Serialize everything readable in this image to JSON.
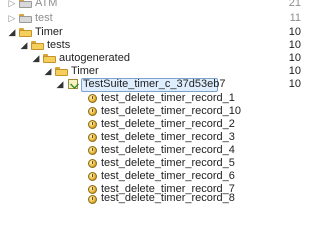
{
  "tree": {
    "rows": [
      {
        "label": "ATM",
        "count": "21",
        "dim": true
      },
      {
        "label": "test",
        "count": "11",
        "dim": true
      },
      {
        "label": "Timer",
        "count": "10"
      },
      {
        "label": "tests",
        "count": "10"
      },
      {
        "label": "autogenerated",
        "count": "10"
      },
      {
        "label": "Timer",
        "count": "10"
      },
      {
        "label": "TestSuite_timer_c_37d53eb7",
        "count": "10"
      },
      {
        "label": "test_delete_timer_record_1"
      },
      {
        "label": "test_delete_timer_record_10"
      },
      {
        "label": "test_delete_timer_record_2"
      },
      {
        "label": "test_delete_timer_record_3"
      },
      {
        "label": "test_delete_timer_record_4"
      },
      {
        "label": "test_delete_timer_record_5"
      },
      {
        "label": "test_delete_timer_record_6"
      },
      {
        "label": "test_delete_timer_record_7"
      },
      {
        "label": "test_delete_timer_record_8"
      }
    ]
  },
  "icons": {
    "project": "project-folder-icon",
    "folder": "folder-icon",
    "suite": "test-suite-icon",
    "testcase": "test-case-icon"
  }
}
